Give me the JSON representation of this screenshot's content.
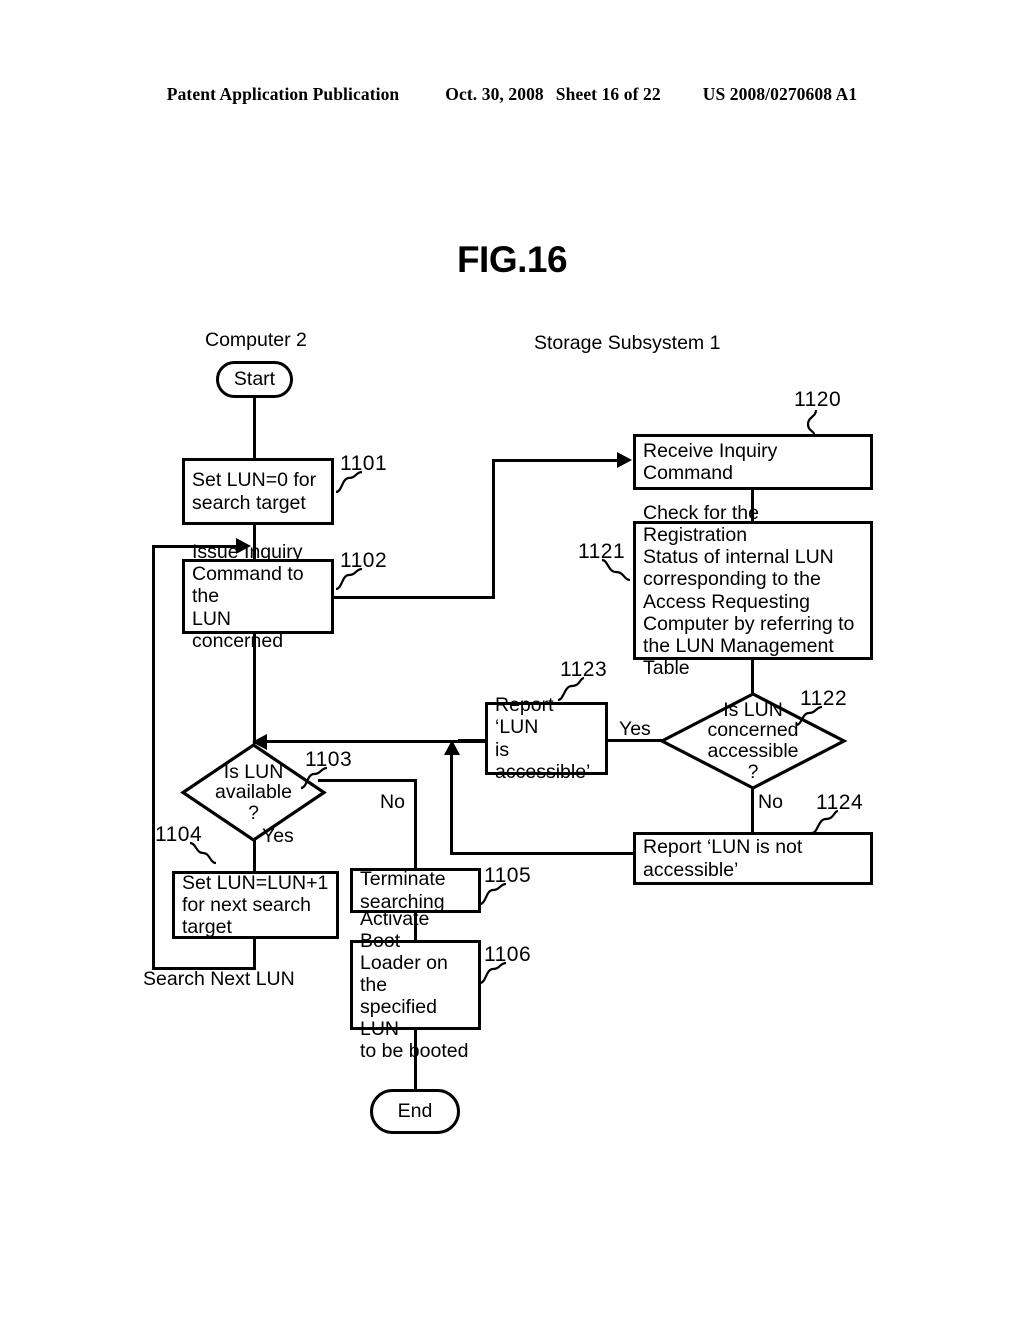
{
  "header": {
    "publication": "Patent Application Publication",
    "date": "Oct. 30, 2008",
    "sheet": "Sheet 16 of 22",
    "patent_number": "US 2008/0270608 A1"
  },
  "figure": {
    "title": "FIG.16"
  },
  "lanes": {
    "left": "Computer 2",
    "right": "Storage Subsystem 1"
  },
  "nodes": {
    "start": "Start",
    "end": "End",
    "n1101": "Set LUN=0 for\nsearch target",
    "n1102": "Issue Inquiry\nCommand to the\nLUN concerned",
    "n1103": "Is LUN\navailable\n?",
    "n1104": "Set LUN=LUN+1\nfor next search\ntarget",
    "n1105": "Terminate\nsearching",
    "n1106": "Activate Boot\nLoader on the\nspecified LUN\nto be booted",
    "n1120": "Receive Inquiry Command",
    "n1121": "Check for the Registration\nStatus of internal LUN\ncorresponding to the\nAccess Requesting\nComputer by referring to\nthe LUN Management\nTable",
    "n1122": "Is LUN\nconcerned\naccessible\n?",
    "n1123": "Report  ‘LUN\nis accessible’",
    "n1124": "Report   ‘LUN is not\naccessible’"
  },
  "refs": {
    "r1101": "1101",
    "r1102": "1102",
    "r1103": "1103",
    "r1104": "1104",
    "r1105": "1105",
    "r1106": "1106",
    "r1120": "1120",
    "r1121": "1121",
    "r1122": "1122",
    "r1123": "1123",
    "r1124": "1124"
  },
  "labels": {
    "yes_left": "Yes",
    "no_left": "No",
    "yes_right": "Yes",
    "no_right": "No",
    "search_next_lun": "Search Next LUN"
  },
  "colors": {
    "ink": "#000000",
    "paper": "#ffffff"
  }
}
